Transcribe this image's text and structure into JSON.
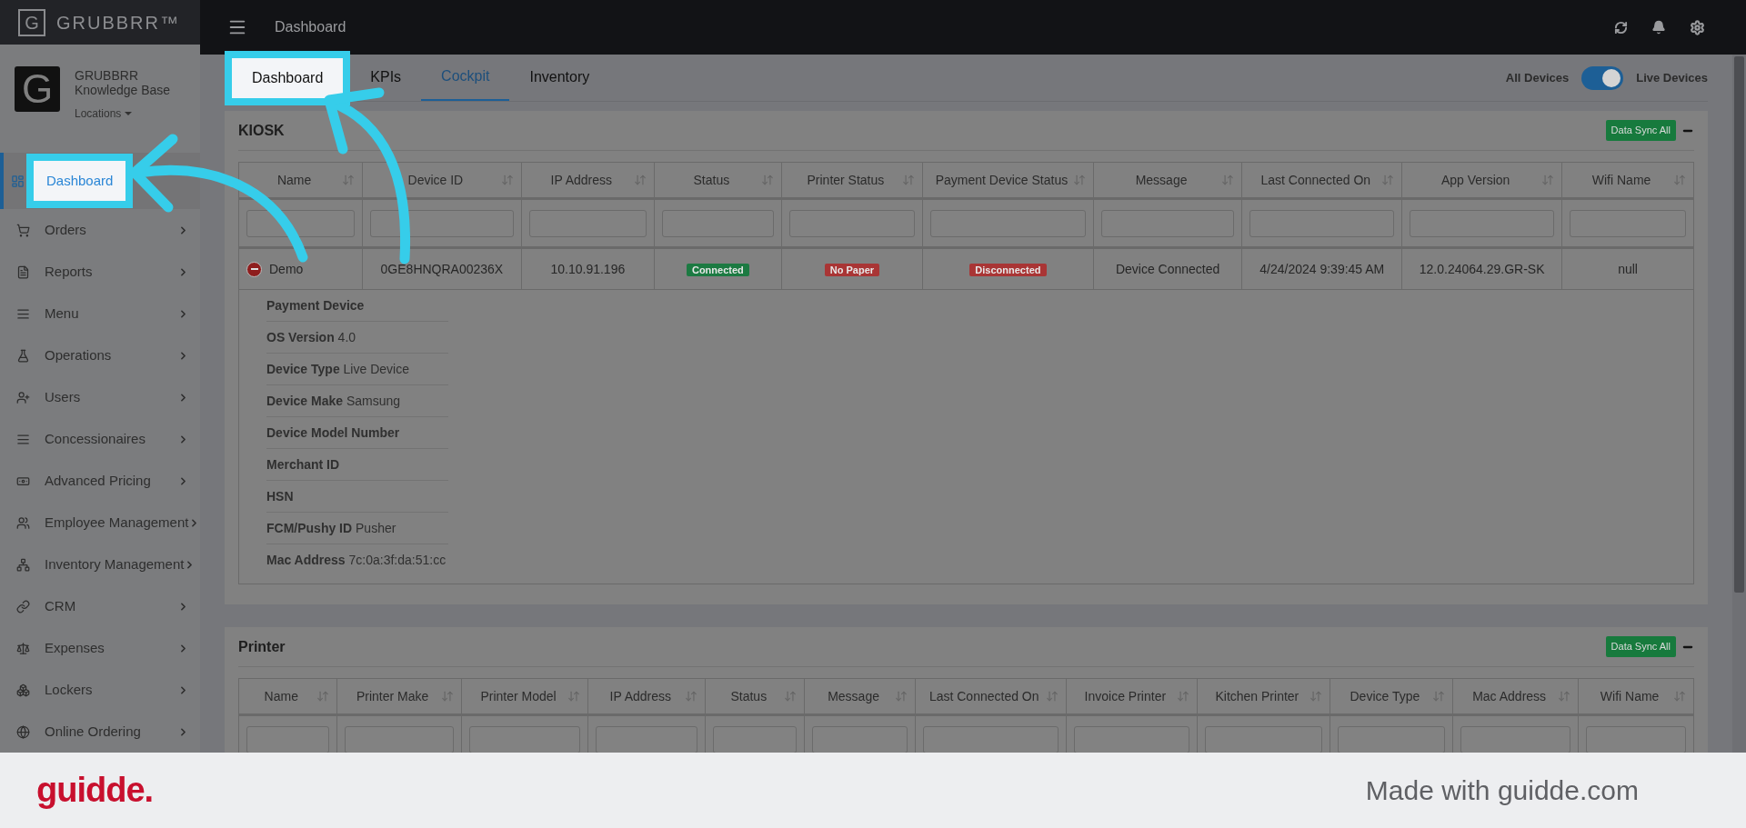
{
  "brand": {
    "logo_letter": "G",
    "name": "GRUBBRR™"
  },
  "topbar": {
    "title": "Dashboard"
  },
  "profile": {
    "logo_letter": "G",
    "name": "GRUBBRR Knowledge Base",
    "locations": "Locations"
  },
  "sidebar": {
    "items": [
      {
        "label": "Dashboard",
        "selected": true,
        "highlighted": true,
        "expandable": false
      },
      {
        "label": "Orders",
        "selected": false,
        "highlighted": false,
        "expandable": true
      },
      {
        "label": "Reports",
        "selected": false,
        "highlighted": false,
        "expandable": true
      },
      {
        "label": "Menu",
        "selected": false,
        "highlighted": false,
        "expandable": true
      },
      {
        "label": "Operations",
        "selected": false,
        "highlighted": false,
        "expandable": true
      },
      {
        "label": "Users",
        "selected": false,
        "highlighted": false,
        "expandable": true
      },
      {
        "label": "Concessionaires",
        "selected": false,
        "highlighted": false,
        "expandable": true
      },
      {
        "label": "Advanced Pricing",
        "selected": false,
        "highlighted": false,
        "expandable": true
      },
      {
        "label": "Employee Management",
        "selected": false,
        "highlighted": false,
        "expandable": true
      },
      {
        "label": "Inventory Management",
        "selected": false,
        "highlighted": false,
        "expandable": true
      },
      {
        "label": "CRM",
        "selected": false,
        "highlighted": false,
        "expandable": true
      },
      {
        "label": "Expenses",
        "selected": false,
        "highlighted": false,
        "expandable": true
      },
      {
        "label": "Lockers",
        "selected": false,
        "highlighted": false,
        "expandable": true
      },
      {
        "label": "Online Ordering",
        "selected": false,
        "highlighted": false,
        "expandable": true
      }
    ]
  },
  "tabs": [
    {
      "label": "Dashboard",
      "selected": false,
      "highlighted": true
    },
    {
      "label": "KPIs",
      "selected": false,
      "highlighted": false
    },
    {
      "label": "Cockpit",
      "selected": true,
      "highlighted": false
    },
    {
      "label": "Inventory",
      "selected": false,
      "highlighted": false
    }
  ],
  "device_filter": {
    "left_label": "All Devices",
    "right_label": "Live Devices",
    "on": true
  },
  "kiosk": {
    "title": "KIOSK",
    "sync_button": "Data Sync All",
    "columns": [
      "Name",
      "Device ID",
      "IP Address",
      "Status",
      "Printer Status",
      "Payment Device Status",
      "Message",
      "Last Connected On",
      "App Version",
      "Wifi Name"
    ],
    "rows": [
      {
        "expanded": true,
        "cells": [
          {
            "kind": "name",
            "text": "Demo"
          },
          {
            "kind": "text",
            "text": "0GE8HNQRA00236X"
          },
          {
            "kind": "text",
            "text": "10.10.91.196"
          },
          {
            "kind": "badge",
            "text": "Connected",
            "color": "#1c7a42"
          },
          {
            "kind": "badge",
            "text": "No Paper",
            "color": "#a93535"
          },
          {
            "kind": "badge",
            "text": "Disconnected",
            "color": "#a93535"
          },
          {
            "kind": "text",
            "text": "Device Connected"
          },
          {
            "kind": "text",
            "text": "4/24/2024 9:39:45 AM"
          },
          {
            "kind": "text",
            "text": "12.0.24064.29.GR-SK"
          },
          {
            "kind": "text",
            "text": "null"
          }
        ],
        "details": [
          {
            "label": "Payment Device"
          },
          {
            "label": "OS Version",
            "value": "4.0"
          },
          {
            "label": "Device Type",
            "value": "Live Device"
          },
          {
            "label": "Device Make",
            "value": "Samsung"
          },
          {
            "label": "Device Model Number"
          },
          {
            "label": "Merchant ID"
          },
          {
            "label": "HSN"
          },
          {
            "label": "FCM/Pushy ID",
            "value": "Pusher"
          },
          {
            "label": "Mac Address",
            "value": "7c:0a:3f:da:51:cc"
          }
        ]
      }
    ]
  },
  "printer": {
    "title": "Printer",
    "sync_button": "Data Sync All",
    "columns": [
      "Name",
      "Printer Make",
      "Printer Model",
      "IP Address",
      "Status",
      "Message",
      "Last Connected On",
      "Invoice Printer",
      "Kitchen Printer",
      "Device Type",
      "Mac Address",
      "Wifi Name"
    ]
  },
  "footer": {
    "brand": "guidde.",
    "tagline": "Made with guidde.com"
  }
}
